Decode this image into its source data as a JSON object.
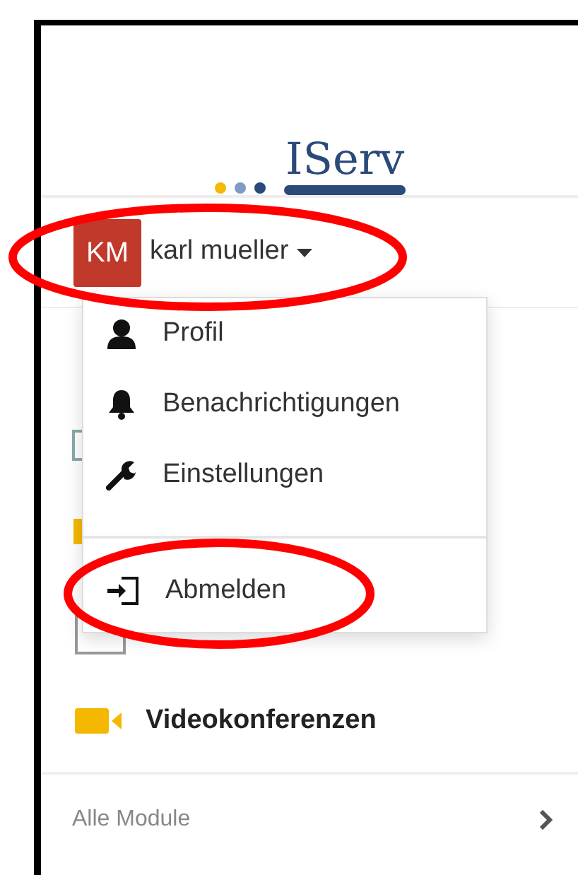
{
  "logo": {
    "text": "IServ"
  },
  "user": {
    "initials": "KM",
    "name": "karl mueller"
  },
  "sidebar": {
    "modules": [
      {
        "kind": "video",
        "label": "Videokonferenzen"
      }
    ],
    "all_modules": "Alle Module"
  },
  "user_menu": [
    {
      "kind": "profile",
      "label": "Profil"
    },
    {
      "kind": "notifications",
      "label": "Benachrichtigungen"
    },
    {
      "kind": "settings",
      "label": "Einstellungen"
    },
    {
      "kind": "logout",
      "label": "Abmelden"
    }
  ]
}
